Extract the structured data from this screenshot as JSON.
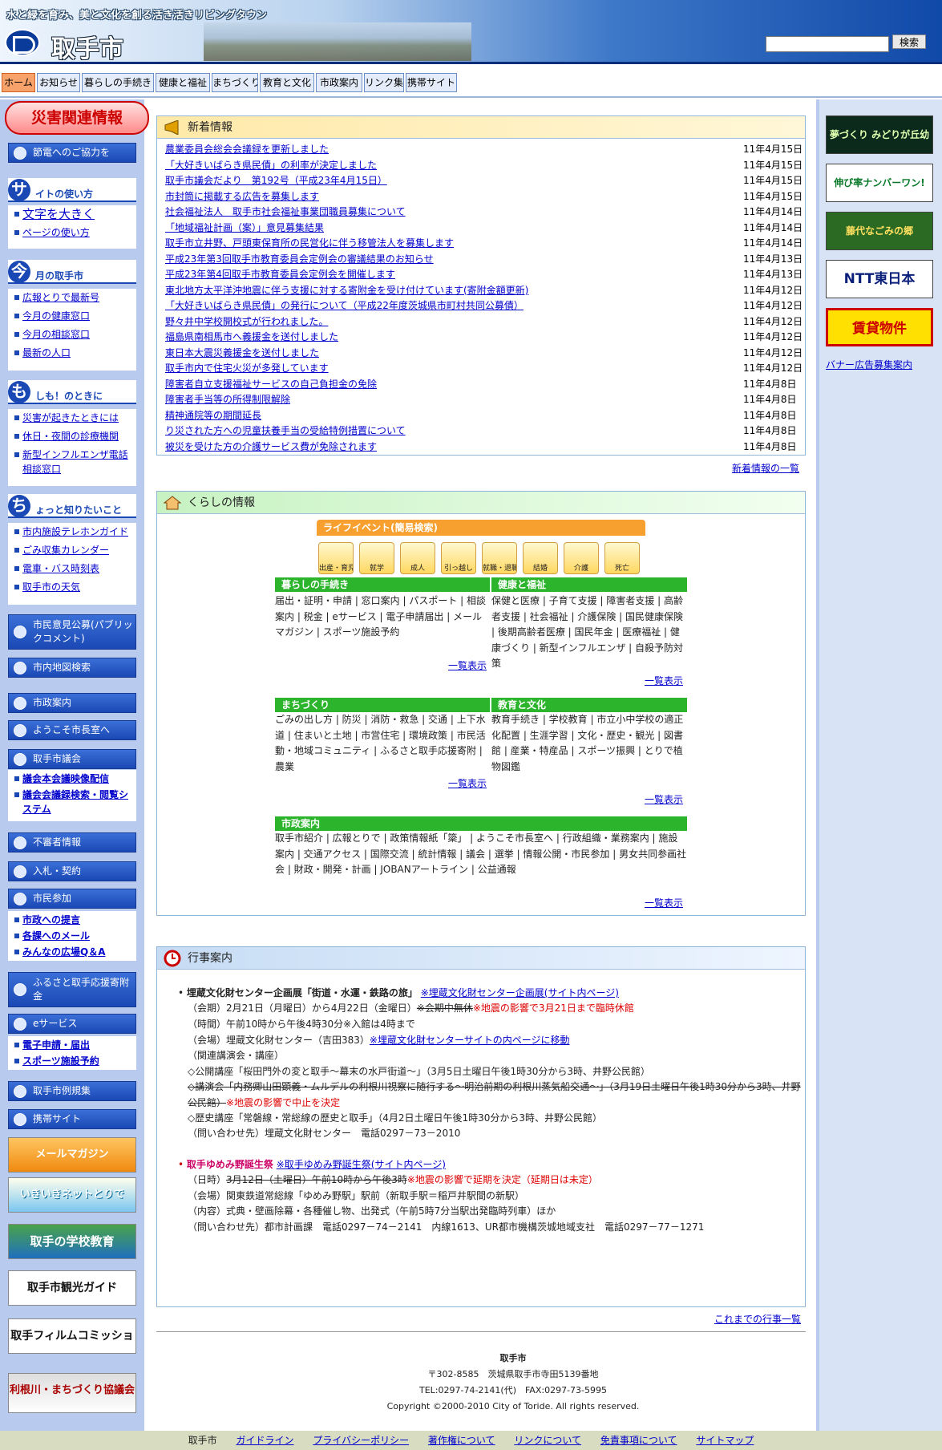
{
  "header": {
    "tagline": "水と緑を育み、美と文化を創る活き活きリビングタウン",
    "city": "取手市",
    "search_button": "検索"
  },
  "nav": [
    "ホーム",
    "お知らせ",
    "暮らしの手続き",
    "健康と福祉",
    "まちづくり",
    "教育と文化",
    "市政案内",
    "リンク集",
    "携帯サイト"
  ],
  "left": {
    "disaster": "災害関連情報",
    "setsuden": "節電へのご協力を",
    "site_head": "イトの使い方",
    "site_big": "サ",
    "site_items": [
      "文字を大きく",
      "ページの使い方"
    ],
    "month_head": "月の取手市",
    "month_big": "今",
    "month_items": [
      "広報とりで最新号",
      "今月の健康窓口",
      "今月の相談窓口",
      "最新の人口"
    ],
    "emg_head": "しも！のときに",
    "emg_big": "も",
    "emg_items": [
      "災害が起きたときには",
      "休日・夜間の診療機関",
      "新型インフルエンザ電話相談窓口"
    ],
    "info_head": "ょっと知りたいこと",
    "info_big": "ち",
    "info_items": [
      "市内施設テレホンガイド",
      "ごみ収集カレンダー",
      "電車・バス時刻表",
      "取手市の天気"
    ],
    "btn_pubcom": "市民意見公募(パブリックコメント)",
    "btn_map": "市内地図検索",
    "btn_shisei": "市政案内",
    "btn_mayor": "ようこそ市長室へ",
    "btn_gikai": "取手市議会",
    "gikai_items": [
      "議会本会議映像配信",
      "議会会議録検索・閲覧システム"
    ],
    "btn_fushin": "不審者情報",
    "btn_nyusatsu": "入札・契約",
    "btn_sanka": "市民参加",
    "sanka_items": [
      "市政への提言",
      "各課へのメール",
      "みんなの広場Q＆A"
    ],
    "btn_furusato": "ふるさと取手応援寄附金",
    "btn_eservice": "eサービス",
    "eservice_items": [
      "電子申請・届出",
      "スポーツ施設予約"
    ],
    "btn_reiki": "取手市例規集",
    "btn_keitai": "携帯サイト",
    "banners": [
      "メールマガジン",
      "いきいきネットとりで",
      "取手の学校教育",
      "取手市観光ガイド",
      "取手フィルムコミッション",
      "利根川・まちづくり協議会"
    ]
  },
  "right": {
    "banners": [
      "夢づくり みどりが丘幼稚園",
      "伸び率ナンバーワン!",
      "藤代なごみの郷",
      "NTT東日本",
      "賃貸物件"
    ],
    "link": "バナー広告募集案内"
  },
  "news": {
    "title": "新着情報",
    "items": [
      {
        "t": "農業委員会総会会議録を更新しました",
        "d": "11年4月15日"
      },
      {
        "t": "「大好きいばらき県民債」の利率が決定しました",
        "d": "11年4月15日"
      },
      {
        "t": "取手市議会だより　第192号（平成23年4月15日）",
        "d": "11年4月15日"
      },
      {
        "t": "市封筒に掲載する広告を募集します",
        "d": "11年4月15日"
      },
      {
        "t": "社会福祉法人　取手市社会福祉事業団職員募集について",
        "d": "11年4月14日"
      },
      {
        "t": "「地域福祉計画（案）」意見募集結果",
        "d": "11年4月14日"
      },
      {
        "t": "取手市立井野、戸頭東保育所の民営化に伴う移管法人を募集します",
        "d": "11年4月14日"
      },
      {
        "t": "平成23年第3回取手市教育委員会定例会の審議結果のお知らせ",
        "d": "11年4月13日"
      },
      {
        "t": "平成23年第4回取手市教育委員会定例会を開催します",
        "d": "11年4月13日"
      },
      {
        "t": "東北地方太平洋沖地震に伴う支援に対する寄附金を受け付けています(寄附金額更新)",
        "d": "11年4月12日"
      },
      {
        "t": "「大好きいばらき県民債」の発行について（平成22年度茨城県市町村共同公募債）",
        "d": "11年4月12日"
      },
      {
        "t": "野々井中学校開校式が行われました。",
        "d": "11年4月12日"
      },
      {
        "t": "福島県南相馬市へ義援金を送付しました",
        "d": "11年4月12日"
      },
      {
        "t": "東日本大震災義援金を送付しました",
        "d": "11年4月12日"
      },
      {
        "t": "取手市内で住宅火災が多発しています",
        "d": "11年4月12日"
      },
      {
        "t": "障害者自立支援福祉サービスの自己負担金の免除",
        "d": "11年4月8日"
      },
      {
        "t": "障害者手当等の所得制限解除",
        "d": "11年4月8日"
      },
      {
        "t": "精神通院等の期間延長",
        "d": "11年4月8日"
      },
      {
        "t": "り災された方への児童扶養手当の受給特例措置について",
        "d": "11年4月8日"
      },
      {
        "t": "被災を受けた方の介護サービス費が免除されます",
        "d": "11年4月8日"
      }
    ],
    "more": "新着情報の一覧"
  },
  "life": {
    "title": "くらしの情報",
    "events_title": "ライフイベント(簡易検索)",
    "events": [
      "出産・育児",
      "就学",
      "成人",
      "引っ越し",
      "就職・退職",
      "結婚",
      "介護",
      "死亡"
    ],
    "kurashi": {
      "title": "暮らしの手続き",
      "body": "届出・証明・申請 | 窓口案内 | パスポート | 相談案内 | 税金 | eサービス | 電子申請届出 | メールマガジン | スポーツ施設予約",
      "more": "一覧表示"
    },
    "kenko": {
      "title": "健康と福祉",
      "body": "保健と医療 | 子育て支援 | 障害者支援 | 高齢者支援 | 社会福祉 | 介護保険 | 国民健康保険 | 後期高齢者医療 | 国民年金 | 医療福祉 | 健康づくり | 新型インフルエンザ | 自殺予防対策",
      "more": "一覧表示"
    },
    "machi": {
      "title": "まちづくり",
      "body": "ごみの出し方 | 防災 | 消防・救急 | 交通 | 上下水道 | 住まいと土地 | 市営住宅 | 環境政策 | 市民活動・地域コミュニティ | ふるさと取手応援寄附 | 農業",
      "more": "一覧表示"
    },
    "kyoiku": {
      "title": "教育と文化",
      "body": "教育手続き | 学校教育 | 市立小中学校の適正化配置 | 生涯学習 | 文化・歴史・観光 | 図書館 | 産業・特産品 | スポーツ振興 | とりで植物図鑑",
      "more": "一覧表示"
    },
    "shisei": {
      "title": "市政案内",
      "body": "取手市紹介 | 広報とりで | 政策情報紙「簗」 | ようこそ市長室へ | 行政組織・業務案内 | 施設案内 | 交通アクセス | 国際交流 | 統計情報 | 議会 | 選挙 | 情報公開・市民参加 | 男女共同参画社会 | 財政・開発・計画 | JOBANアートライン | 公益通報",
      "more": "一覧表示"
    }
  },
  "event": {
    "title": "行事案内",
    "e1_title": "埋蔵文化財センター企画展「街道・水運・鉄路の旅」",
    "e1_link": "※埋蔵文化財センター企画展(サイト内ページ)",
    "e1_l1a": "（会期）2月21日（月曜日）から4月22日（金曜日）",
    "e1_l1s": "※会期中無休",
    "e1_l1r": "※地震の影響で3月21日まで臨時休館",
    "e1_l2": "（時間）午前10時から午後4時30分※入館は4時まで",
    "e1_l3a": "（会場）埋蔵文化財センター（吉田383）",
    "e1_l3l": "※埋蔵文化財センターサイトの内ページに移動",
    "e1_l4": "（関連講演会・講座）",
    "e1_l5": "◇公開講座「桜田門外の変と取手～幕末の水戸街道～」（3月5日土曜日午後1時30分から3時、井野公民館）",
    "e1_l6s": "◇講演会「内務卿山田顕義・ムルデルの利根川視察に随行する～明治前期の利根川蒸気船交通～」（3月19日土曜日午後1時30分から3時、井野公民館）",
    "e1_l6r": "※地震の影響で中止を決定",
    "e1_l7": "◇歴史講座「常磐線・常総線の歴史と取手」（4月2日土曜日午後1時30分から3時、井野公民館）",
    "e1_l8": "（問い合わせ先）埋蔵文化財センター　電話0297－73－2010",
    "e2_title": "取手ゆめみ野誕生祭",
    "e2_link": "※取手ゆめみ野誕生祭(サイト内ページ)",
    "e2_l1a": "（日時）",
    "e2_l1s": "3月12日（土曜日）午前10時から午後3時",
    "e2_l1r": "※地震の影響で延期を決定（延期日は未定）",
    "e2_l2": "（会場）関東鉄道常総線「ゆめみ野駅」駅前（新取手駅＝稲戸井駅間の新駅）",
    "e2_l3": "（内容）式典・壁画除幕・各種催し物、出発式（午前5時7分当駅出発臨時列車）ほか",
    "e2_l4": "（問い合わせ先）都市計画課　電話0297－74－2141　内線1613、UR都市機構茨城地域支社　電話0297－77－1271",
    "more": "これまでの行事一覧"
  },
  "footer": {
    "name": "取手市",
    "addr": "〒302-8585　茨城県取手市寺田5139番地",
    "tel": "TEL:0297-74-2141(代)　FAX:0297-73-5995",
    "copy": "Copyright ©2000-2010 City of Toride. All rights reserved.",
    "links": [
      "取手市",
      "ガイドライン",
      "プライバシーポリシー",
      "著作権について",
      "リンクについて",
      "免責事項について",
      "サイトマップ"
    ]
  }
}
